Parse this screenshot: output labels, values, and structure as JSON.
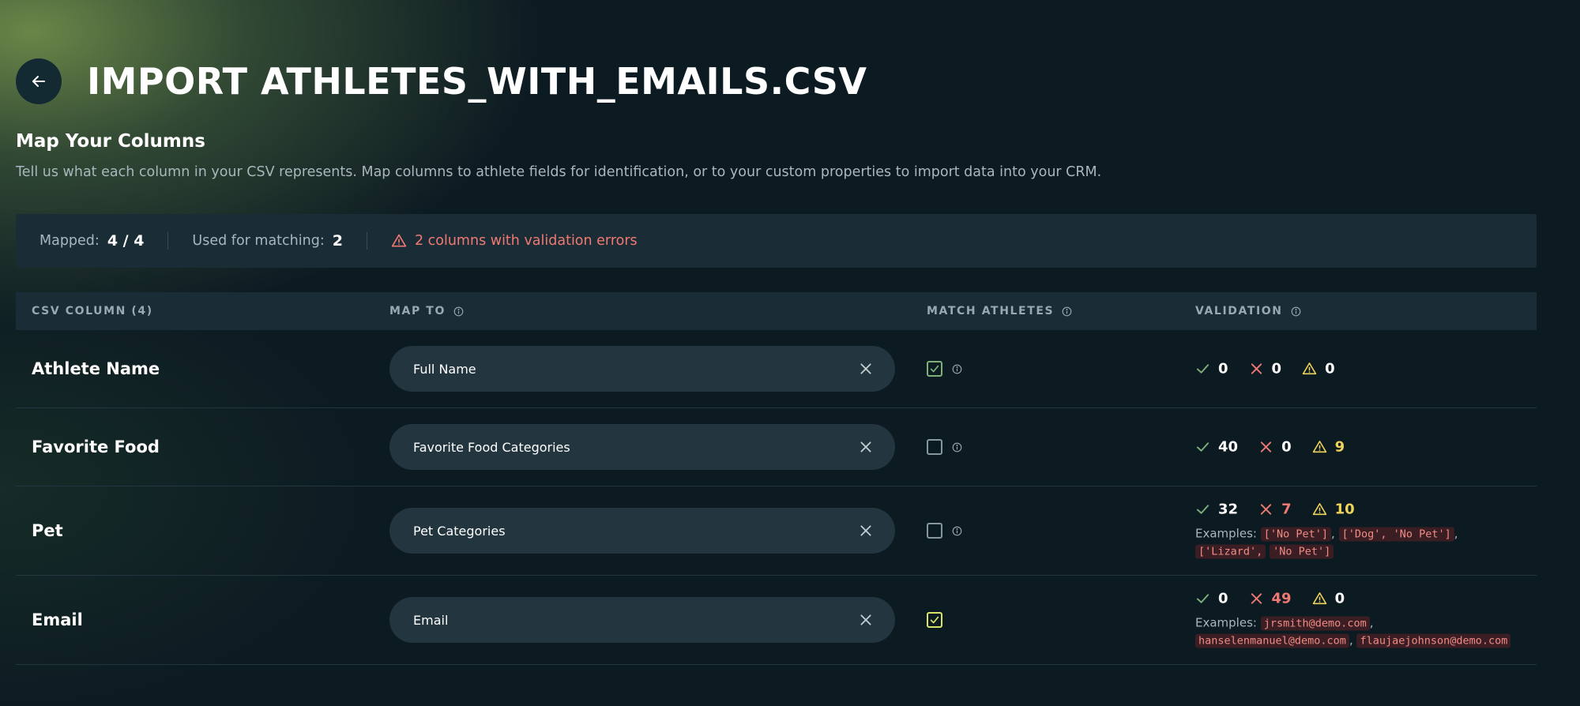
{
  "header": {
    "back_icon": "arrow-left-icon",
    "title": "IMPORT ATHLETES_WITH_EMAILS.CSV"
  },
  "section": {
    "title": "Map Your Columns",
    "description": "Tell us what each column in your CSV represents. Map columns to athlete fields for identification, or to your custom properties to import data into your CRM."
  },
  "summary": {
    "mapped_label": "Mapped:",
    "mapped_value": "4 / 4",
    "matching_label": "Used for matching:",
    "matching_value": "2",
    "error_text": "2 columns with validation errors",
    "error_color": "#f07a73"
  },
  "table": {
    "headers": {
      "csv_column": "CSV COLUMN (4)",
      "map_to": "MAP TO",
      "match_athletes": "MATCH ATHLETES",
      "validation": "VALIDATION"
    },
    "rows": [
      {
        "name": "Athlete Name",
        "map_to": "Full Name",
        "match_checked": true,
        "valid": "0",
        "errors": "0",
        "warnings": "0"
      },
      {
        "name": "Favorite Food",
        "map_to": "Favorite Food Categories",
        "match_checked": false,
        "valid": "40",
        "errors": "0",
        "warnings": "9"
      },
      {
        "name": "Pet",
        "map_to": "Pet Categories",
        "match_checked": false,
        "valid": "32",
        "errors": "7",
        "warnings": "10",
        "examples_label": "Examples:",
        "examples": [
          "['No Pet']",
          "['Dog', 'No Pet']",
          "['Lizard',",
          "'No Pet']"
        ]
      },
      {
        "name": "Email",
        "map_to": "Email",
        "match_checked": true,
        "valid": "0",
        "errors": "49",
        "warnings": "0",
        "examples_label": "Examples:",
        "examples": [
          "jrsmith@demo.com",
          "hanselenmanuel@demo.com",
          "flaujaejohnson@demo.com"
        ]
      }
    ]
  },
  "colors": {
    "accent_green": "#7fb07a",
    "error_red": "#f07a73",
    "warning_yellow": "#f0d35a"
  }
}
